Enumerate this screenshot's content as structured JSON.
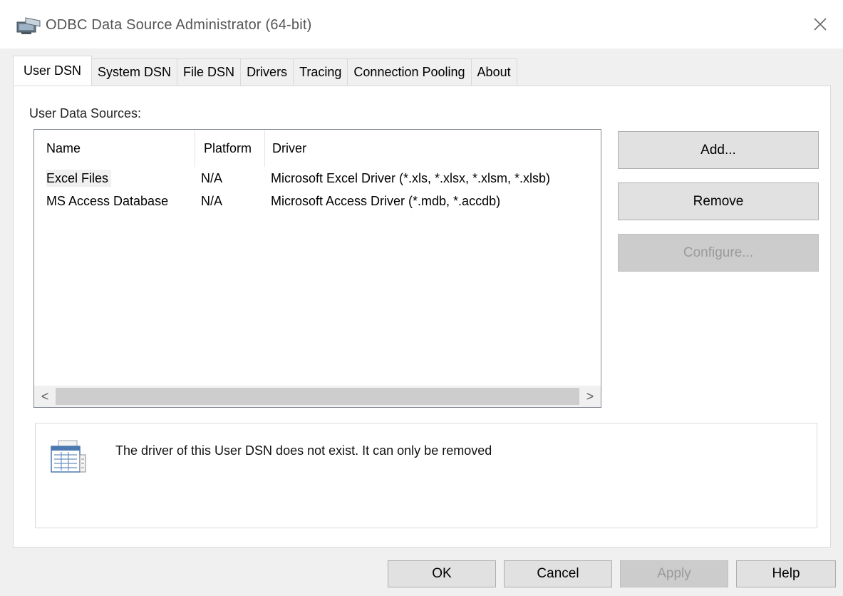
{
  "window": {
    "title": "ODBC Data Source Administrator (64-bit)",
    "close_glyph": "✕"
  },
  "tabs": [
    {
      "label": "User DSN",
      "active": true
    },
    {
      "label": "System DSN",
      "active": false
    },
    {
      "label": "File DSN",
      "active": false
    },
    {
      "label": "Drivers",
      "active": false
    },
    {
      "label": "Tracing",
      "active": false
    },
    {
      "label": "Connection Pooling",
      "active": false
    },
    {
      "label": "About",
      "active": false
    }
  ],
  "user_dsn": {
    "group_label": "User Data Sources:",
    "columns": [
      "Name",
      "Platform",
      "Driver"
    ],
    "rows": [
      {
        "name": "Excel Files",
        "platform": "N/A",
        "driver": "Microsoft Excel Driver (*.xls, *.xlsx, *.xlsm, *.xlsb)",
        "selected": true
      },
      {
        "name": "MS Access Database",
        "platform": "N/A",
        "driver": "Microsoft Access Driver (*.mdb, *.accdb)",
        "selected": false
      }
    ],
    "scroll_left": "<",
    "scroll_right": ">",
    "buttons": {
      "add": "Add...",
      "remove": "Remove",
      "configure": "Configure..."
    },
    "info_text": "The driver of this User DSN does not exist. It can only be removed"
  },
  "footer": {
    "ok": "OK",
    "cancel": "Cancel",
    "apply": "Apply",
    "help": "Help"
  },
  "icons": {
    "title": "odbc-app-icon",
    "info": "data-table-icon",
    "close": "close-icon"
  },
  "colors": {
    "panel_bg": "#ffffff",
    "dialog_bg": "#f0f0f0",
    "button_bg": "#e1e1e1",
    "disabled_text": "#9a9a9a"
  }
}
